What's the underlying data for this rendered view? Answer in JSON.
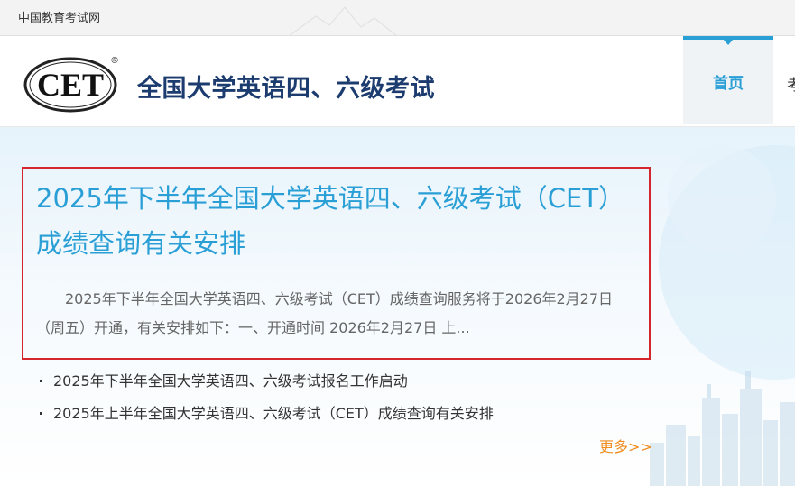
{
  "topbar": {
    "site_name": "中国教育考试网"
  },
  "header": {
    "logo": {
      "text": "CET",
      "registered": "®"
    },
    "title": "全国大学英语四、六级考试"
  },
  "nav": {
    "home_label": "首页",
    "next_label_partial": "考"
  },
  "featured": {
    "title": "2025年下半年全国大学英语四、六级考试（CET）成绩查询有关安排",
    "summary": "2025年下半年全国大学英语四、六级考试（CET）成绩查询服务将于2026年2月27日（周五）开通，有关安排如下：一、开通时间 2026年2月27日 上..."
  },
  "news": [
    {
      "title": "2025年下半年全国大学英语四、六级考试报名工作启动"
    },
    {
      "title": "2025年上半年全国大学英语四、六级考试（CET）成绩查询有关安排"
    }
  ],
  "more_label": "更多>>",
  "colors": {
    "accent_blue": "#2a9fd6",
    "title_navy": "#1c3b6e",
    "highlight_red": "#d4262c",
    "more_orange": "#f08c1e"
  }
}
